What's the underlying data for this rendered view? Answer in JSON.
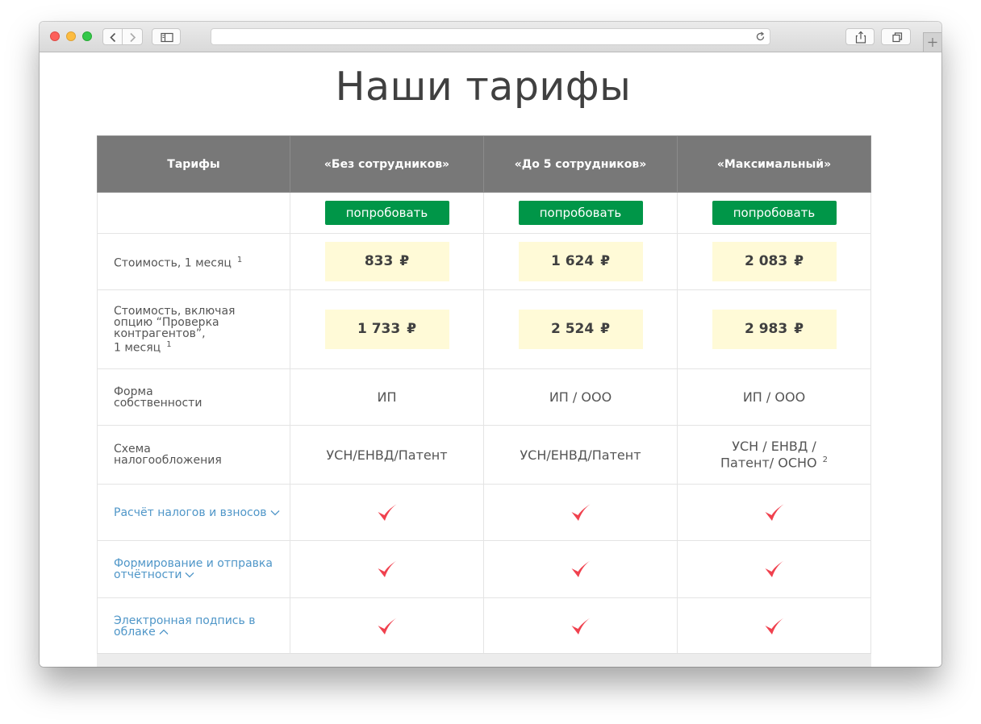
{
  "page": {
    "title": "Наши тарифы"
  },
  "table": {
    "headers": [
      "Тарифы",
      "«Без сотрудников»",
      "«До 5 сотрудников»",
      "«Максимальный»"
    ],
    "try_label": "попробовать",
    "rows": {
      "cost_month": {
        "label": "Стоимость, 1 месяц",
        "note": "1",
        "values": [
          "833",
          "1 624",
          "2 083"
        ],
        "currency": "₽"
      },
      "cost_check": {
        "label_lines": [
          "Стоимость, включая",
          "опцию “Проверка",
          "контрагентов”,",
          "1 месяц"
        ],
        "note": "1",
        "values": [
          "1 733",
          "2 524",
          "2 983"
        ],
        "currency": "₽"
      },
      "ownership": {
        "label_lines": [
          "Форма",
          "собственности"
        ],
        "values": [
          "ИП",
          "ИП / ООО",
          "ИП / ООО"
        ]
      },
      "tax": {
        "label_lines": [
          "Схема",
          "налогообложения"
        ],
        "values": [
          "УСН/ЕНВД/Патент",
          "УСН/ЕНВД/Патент"
        ],
        "value3_lines": [
          "УСН / ЕНВД /",
          "Патент/ ОСНО"
        ],
        "value3_note": "2"
      },
      "taxes_calc": {
        "label": "Расчёт налогов и взносов",
        "arrow": "chevron-down-icon"
      },
      "reports": {
        "label_lines": [
          "Формирование и отправка",
          "отчётности"
        ],
        "arrow": "chevron-down-icon"
      },
      "signature": {
        "label_lines": [
          "Электронная подпись в",
          "облаке"
        ],
        "arrow": "chevron-up-icon"
      }
    }
  },
  "colors": {
    "header_bg": "#787878",
    "button_green": "#009648",
    "price_bg": "#fffad7",
    "check_red": "#f0414e",
    "link_blue": "#4f96c8"
  }
}
